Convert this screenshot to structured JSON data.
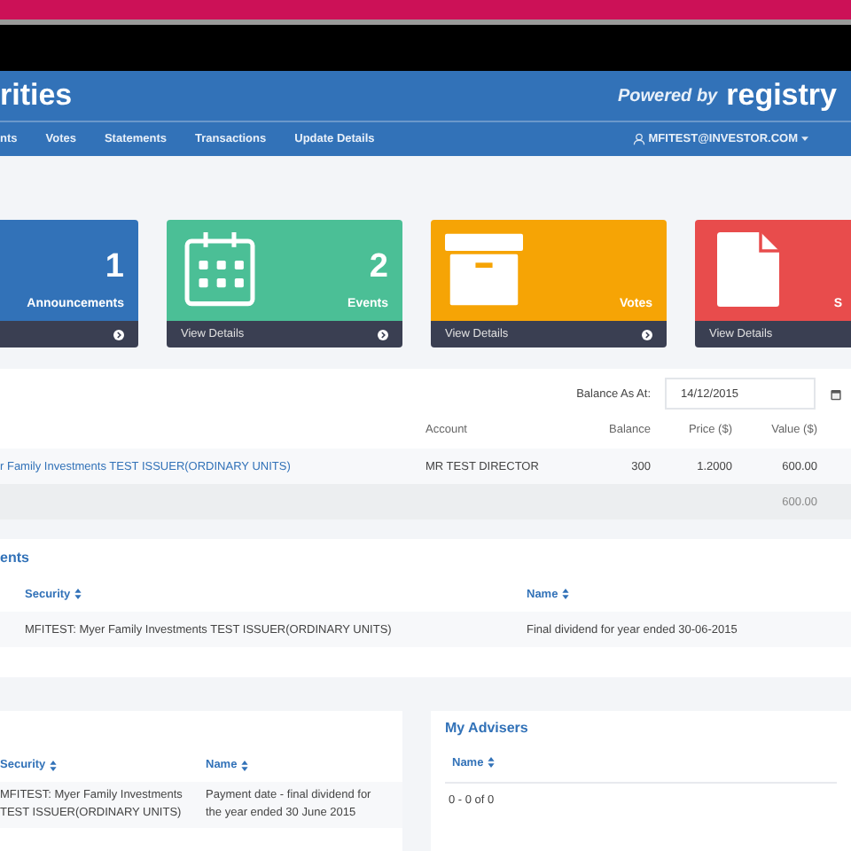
{
  "header": {
    "title": "rities",
    "powered_by": "Powered by",
    "brand": "registry"
  },
  "nav": [
    {
      "label": "nts"
    },
    {
      "label": "Votes"
    },
    {
      "label": "Statements"
    },
    {
      "label": "Transactions"
    },
    {
      "label": "Update Details"
    }
  ],
  "user": {
    "label": "MFITEST@INVESTOR.COM"
  },
  "cards": [
    {
      "kind": "none",
      "color": "#3272b8",
      "count": "1",
      "label": "Announcements"
    },
    {
      "kind": "calendar",
      "color": "#4bbf96",
      "count": "2",
      "label": "Events",
      "footer": "View Details"
    },
    {
      "kind": "box",
      "color": "#f6a405",
      "label": "Votes",
      "footer": "View Details"
    },
    {
      "kind": "document",
      "color": "#e84c4c",
      "label": "S",
      "footer": "View Details"
    }
  ],
  "holdings": {
    "balance_label": "Balance As At:",
    "date": "14/12/2015",
    "columns": [
      "Account",
      "Balance",
      "Price ($)",
      "Value ($)"
    ],
    "rows": [
      {
        "security": "r Family Investments TEST ISSUER(ORDINARY UNITS)",
        "account": "MR TEST DIRECTOR",
        "balance": "300",
        "price": "1.2000",
        "value": "600.00"
      }
    ],
    "total": "600.00"
  },
  "announcements": {
    "title": "ents",
    "columns": [
      "Security",
      "Name"
    ],
    "rows": [
      {
        "security": "MFITEST: Myer Family Investments TEST ISSUER(ORDINARY UNITS)",
        "name": "Final dividend for year ended 30-06-2015"
      }
    ]
  },
  "events": {
    "columns": [
      "Security",
      "Name"
    ],
    "rows": [
      {
        "security": "MFITEST: Myer Family Investments TEST ISSUER(ORDINARY UNITS)",
        "name": "Payment date - final dividend for the year ended 30 June 2015"
      }
    ]
  },
  "advisers": {
    "title": "My Advisers",
    "columns": [
      "Name"
    ],
    "empty_text": "0 - 0 of 0"
  }
}
